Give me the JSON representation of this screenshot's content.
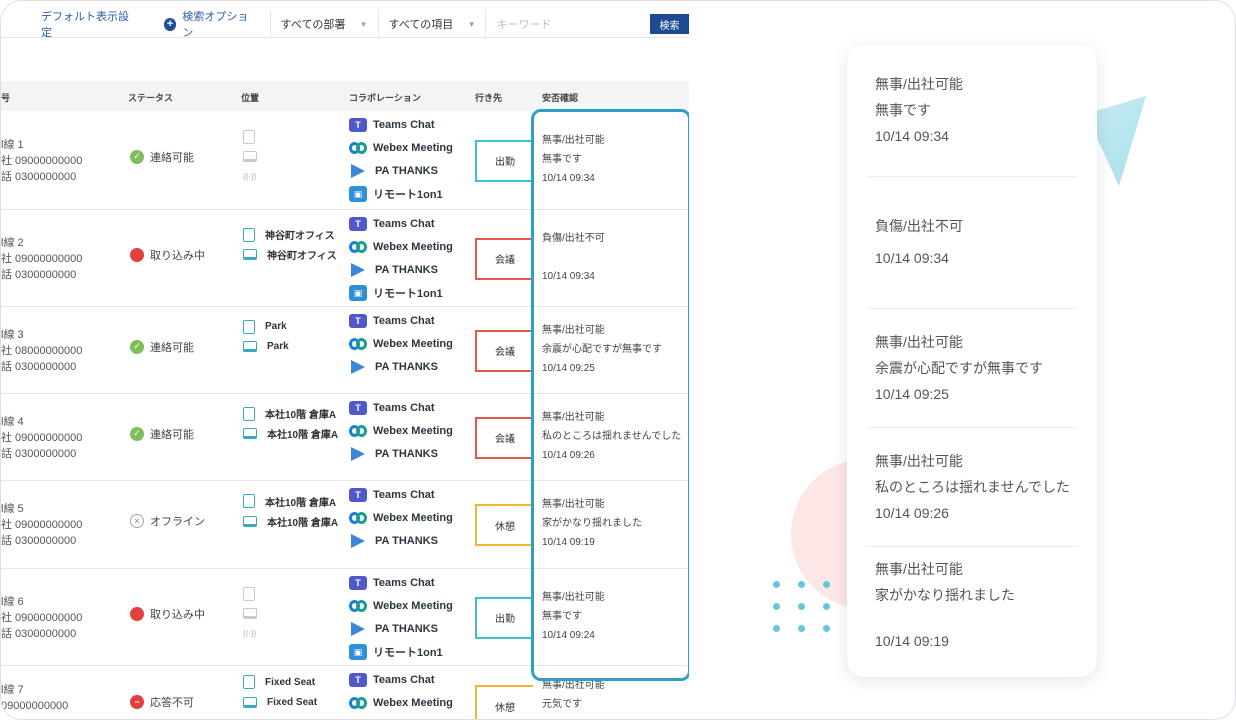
{
  "toolbar": {
    "default_view": "デフォルト表示設定",
    "search_options": "検索オプション",
    "dept_select": "すべての部署",
    "item_select": "すべての項目",
    "keyword_placeholder": "キーワード",
    "search_button": "検索"
  },
  "table": {
    "headers": {
      "id": "号",
      "status": "ステータス",
      "location": "位置",
      "collab": "コラボレーション",
      "destination": "行き先",
      "safety": "安否確認"
    },
    "collab_labels": {
      "teams": "Teams Chat",
      "webex": "Webex Meeting",
      "pa": "PA THANKS",
      "remote": "リモート1on1"
    },
    "rows": [
      {
        "ext": "l線 1",
        "company": "社 09000000000",
        "phone": "話 0300000000",
        "status": "連絡可能",
        "status_type": "ok",
        "loc1": "",
        "loc2": "",
        "dest": "出勤",
        "dest_color": "#3fbfd2",
        "safety1": "無事/出社可能",
        "safety2": "無事です",
        "safety_time": "10/14 09:34"
      },
      {
        "ext": "l線 2",
        "company": "社 09000000000",
        "phone": "話 0300000000",
        "status": "取り込み中",
        "status_type": "busy",
        "loc1": "神谷町オフィス",
        "loc2": "神谷町オフィス",
        "dest": "会議",
        "dest_color": "#e0594a",
        "safety1": "負傷/出社不可",
        "safety2": "",
        "safety_time": "10/14 09:34"
      },
      {
        "ext": "l線 3",
        "company": "社 08000000000",
        "phone": "話 0300000000",
        "status": "連絡可能",
        "status_type": "ok",
        "loc1": "Park",
        "loc2": "Park",
        "dest": "会議",
        "dest_color": "#e0594a",
        "safety1": "無事/出社可能",
        "safety2": "余震が心配ですが無事です",
        "safety_time": "10/14 09:25"
      },
      {
        "ext": "l線 4",
        "company": "社 09000000000",
        "phone": "話 0300000000",
        "status": "連絡可能",
        "status_type": "ok",
        "loc1": "本社10階 倉庫A",
        "loc2": "本社10階 倉庫A",
        "dest": "会議",
        "dest_color": "#e0594a",
        "safety1": "無事/出社可能",
        "safety2": "私のところは揺れませんでした",
        "safety_time": "10/14 09:26"
      },
      {
        "ext": "l線 5",
        "company": "社 09000000000",
        "phone": "話 0300000000",
        "status": "オフライン",
        "status_type": "off",
        "loc1": "本社10階 倉庫A",
        "loc2": "本社10階 倉庫A",
        "dest": "休憩",
        "dest_color": "#f0b43a",
        "safety1": "無事/出社可能",
        "safety2": "家がかなり揺れました",
        "safety_time": "10/14 09:19"
      },
      {
        "ext": "l線 6",
        "company": "社 09000000000",
        "phone": "話 0300000000",
        "status": "取り込み中",
        "status_type": "busy",
        "loc1": "",
        "loc2": "",
        "dest": "出勤",
        "dest_color": "#3fbfd2",
        "safety1": "無事/出社可能",
        "safety2": "無事です",
        "safety_time": "10/14 09:24"
      },
      {
        "ext": "l線 7",
        "company": "09000000000",
        "phone": "",
        "status": "応答不可",
        "status_type": "na",
        "loc1": "Fixed Seat",
        "loc2": "Fixed Seat",
        "dest": "休憩",
        "dest_color": "#f0b43a",
        "safety1": "無事/出社可能",
        "safety2": "元気です",
        "safety_time": ""
      }
    ]
  },
  "showcase": {
    "entries": [
      {
        "line1": "無事/出社可能",
        "line2": "無事です",
        "time": "10/14 09:34"
      },
      {
        "line1": "負傷/出社不可",
        "line2": "",
        "time": "10/14 09:34"
      },
      {
        "line1": "無事/出社可能",
        "line2": "余震が心配ですが無事です",
        "time": "10/14 09:25"
      },
      {
        "line1": "無事/出社可能",
        "line2": "私のところは揺れませんでした",
        "time": "10/14 09:26"
      },
      {
        "line1": "無事/出社可能",
        "line2": "家がかなり揺れました",
        "time": "10/14 09:19"
      }
    ]
  },
  "colors": {
    "accent": "#1e4a93",
    "highlight": "#2fa0c3",
    "ok": "#7fbf5a",
    "busy": "#e0413e"
  }
}
